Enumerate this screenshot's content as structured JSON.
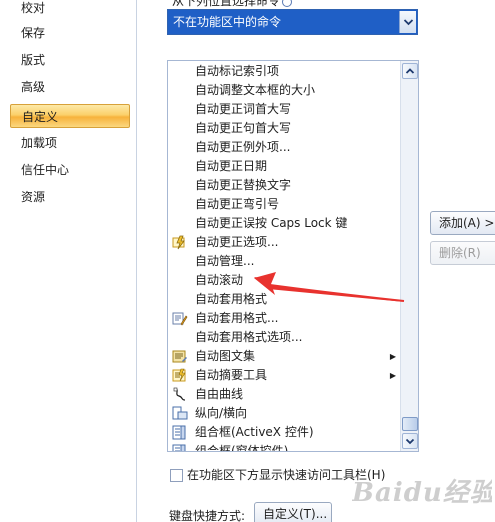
{
  "nav": {
    "items": [
      {
        "label": "校对",
        "name": "nav-item-proofing"
      },
      {
        "label": "保存",
        "name": "nav-item-save"
      },
      {
        "label": "版式",
        "name": "nav-item-layout"
      },
      {
        "label": "高级",
        "name": "nav-item-advanced"
      },
      {
        "label": "自定义",
        "name": "nav-item-customize"
      },
      {
        "label": "加载项",
        "name": "nav-item-addins"
      },
      {
        "label": "信任中心",
        "name": "nav-item-trust-center"
      },
      {
        "label": "资源",
        "name": "nav-item-resources"
      }
    ],
    "selected_index": 4
  },
  "top_label": "从下列位置选择命令",
  "command_source": {
    "value": "不在功能区中的命令"
  },
  "commands": [
    {
      "label": "自动标记索引项",
      "icon": "",
      "submenu": false
    },
    {
      "label": "自动调整文本框的大小",
      "icon": "",
      "submenu": false
    },
    {
      "label": "自动更正词首大写",
      "icon": "",
      "submenu": false
    },
    {
      "label": "自动更正句首大写",
      "icon": "",
      "submenu": false
    },
    {
      "label": "自动更正例外项...",
      "icon": "",
      "submenu": false
    },
    {
      "label": "自动更正日期",
      "icon": "",
      "submenu": false
    },
    {
      "label": "自动更正替换文字",
      "icon": "",
      "submenu": false
    },
    {
      "label": "自动更正弯引号",
      "icon": "",
      "submenu": false
    },
    {
      "label": "自动更正误按 Caps Lock 键",
      "icon": "",
      "submenu": false
    },
    {
      "label": "自动更正选项...",
      "icon": "lightning-icon",
      "submenu": false
    },
    {
      "label": "自动管理...",
      "icon": "",
      "submenu": false
    },
    {
      "label": "自动滚动",
      "icon": "",
      "submenu": false
    },
    {
      "label": "自动套用格式",
      "icon": "",
      "submenu": false
    },
    {
      "label": "自动套用格式...",
      "icon": "format-pencil-icon",
      "submenu": false
    },
    {
      "label": "自动套用格式选项...",
      "icon": "",
      "submenu": false
    },
    {
      "label": "自动图文集",
      "icon": "autotext-icon",
      "submenu": true
    },
    {
      "label": "自动摘要工具",
      "icon": "summary-icon",
      "submenu": true
    },
    {
      "label": "自由曲线",
      "icon": "freeform-curve-icon",
      "submenu": false
    },
    {
      "label": "纵向/横向",
      "icon": "orientation-icon",
      "submenu": false
    },
    {
      "label": "组合框(ActiveX 控件)",
      "icon": "combobox-icon",
      "submenu": false
    },
    {
      "label": "组合框(窗体控件)",
      "icon": "combobox-form-icon",
      "submenu": false
    }
  ],
  "buttons": {
    "add": "添加(A) >>",
    "remove": "删除(R)",
    "customize": "自定义(T)..."
  },
  "checkbox": {
    "label": "在功能区下方显示快速访问工具栏(H)",
    "checked": false
  },
  "shortcut_label": "键盘快捷方式:",
  "watermark": "Baidu经验",
  "colors": {
    "selection_blue": "#1f5fc6",
    "nav_selected_orange": "#f7b23b",
    "annotation_red": "#e8322e"
  }
}
